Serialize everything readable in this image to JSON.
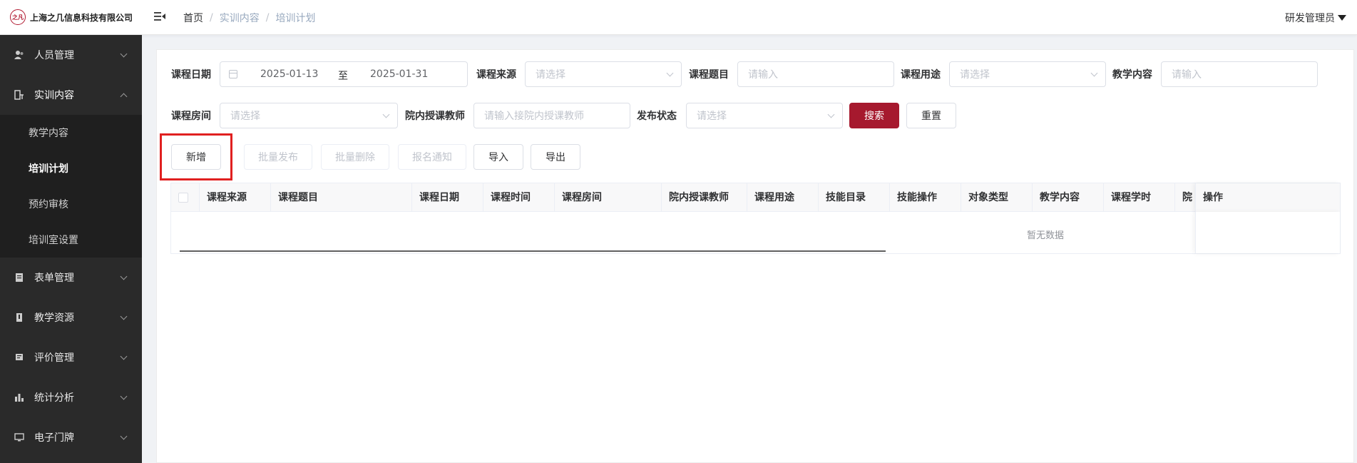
{
  "header": {
    "logo_mark": "之凡",
    "company": "上海之几信息科技有限公司",
    "breadcrumb": [
      "首页",
      "实训内容",
      "培训计划"
    ],
    "user": "研发管理员"
  },
  "sidebar": {
    "items": [
      {
        "label": "人员管理",
        "icon": "users-icon"
      },
      {
        "label": "实训内容",
        "icon": "training-icon",
        "open": true,
        "children": [
          "教学内容",
          "培训计划",
          "预约审核",
          "培训室设置"
        ],
        "active_child": "培训计划"
      },
      {
        "label": "表单管理",
        "icon": "form-icon"
      },
      {
        "label": "教学资源",
        "icon": "resource-icon"
      },
      {
        "label": "评价管理",
        "icon": "evaluation-icon"
      },
      {
        "label": "统计分析",
        "icon": "bar-chart-icon"
      },
      {
        "label": "电子门牌",
        "icon": "monitor-icon"
      }
    ]
  },
  "filters": {
    "date_label": "课程日期",
    "date_start": "2025-01-13",
    "date_sep": "至",
    "date_end": "2025-01-31",
    "source_label": "课程来源",
    "source_placeholder": "请选择",
    "topic_label": "课程题目",
    "topic_placeholder": "请输入",
    "usage_label": "课程用途",
    "usage_placeholder": "请选择",
    "content_label": "教学内容",
    "content_placeholder": "请输入",
    "room_label": "课程房间",
    "room_placeholder": "请选择",
    "teacher_label": "院内授课教师",
    "teacher_placeholder": "请输入接院内授课教师",
    "status_label": "发布状态",
    "status_placeholder": "请选择",
    "search": "搜索",
    "reset": "重置"
  },
  "toolbar": {
    "add": "新增",
    "batch_publish": "批量发布",
    "batch_delete": "批量删除",
    "notify": "报名通知",
    "import": "导入",
    "export": "导出"
  },
  "table": {
    "columns": [
      "课程来源",
      "课程题目",
      "课程日期",
      "课程时间",
      "课程房间",
      "院内授课教师",
      "课程用途",
      "技能目录",
      "技能操作",
      "对象类型",
      "教学内容",
      "课程学时",
      "院"
    ],
    "action_column": "操作",
    "empty_text": "暂无数据"
  },
  "accent_color": "#a6192e"
}
